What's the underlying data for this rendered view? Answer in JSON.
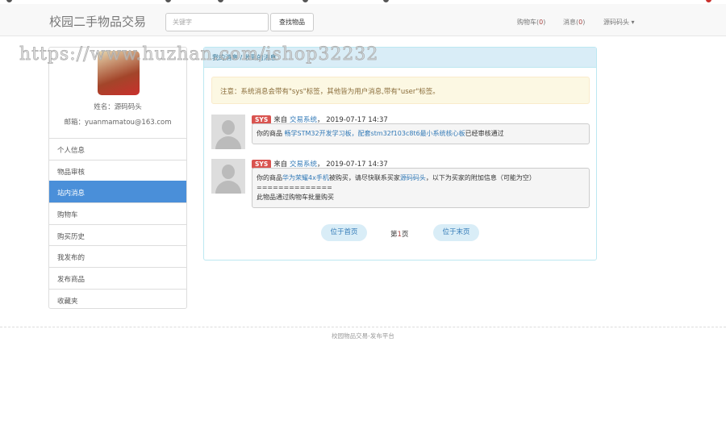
{
  "watermark": "https://www.huzhan.com/ishop32232",
  "navbar": {
    "brand": "校园二手物品交易",
    "search_placeholder": "关键字",
    "search_button": "查找物品",
    "cart_label": "购物车(",
    "cart_count": "0",
    "messages_label": "消息(",
    "messages_count": "0",
    "close_paren": ")",
    "user_menu": "源码码头 ▾"
  },
  "sidebar": {
    "name": "姓名：源码码头",
    "email": "邮箱：yuanmamatou@163.com",
    "items": [
      {
        "label": "个人信息"
      },
      {
        "label": "物品审核"
      },
      {
        "label": "站内消息"
      },
      {
        "label": "购物车"
      },
      {
        "label": "购买历史"
      },
      {
        "label": "我发布的"
      },
      {
        "label": "发布商品"
      },
      {
        "label": "收藏夹"
      }
    ]
  },
  "panel": {
    "title": "我的消息 / 收到的消息",
    "notice": "注意：系统消息会带有\"sys\"标签，其他皆为用户消息,带有\"user\"标签。",
    "messages": [
      {
        "tag": "SYS",
        "from_prefix": "来自",
        "from": "交易系统",
        "sep": "，",
        "time": "2019-07-17 14:37",
        "p1": "你的商品 ",
        "item": "畅学STM32开发学习板，配套stm32f103c8t6最小系统核心板",
        "p2": "已经审核通过"
      },
      {
        "tag": "SYS",
        "from_prefix": "来自",
        "from": "交易系统",
        "sep": "，",
        "time": "2019-07-17 14:37",
        "p1": "你的商品",
        "item": "华为荣耀4x手机",
        "p2": "被购买，请尽快联系买家",
        "buyer": "源码码头",
        "p3": "，以下为买家的附加信息（可能为空）",
        "divider": "==============",
        "extra": "此物品通过购物车批量购买"
      }
    ],
    "pagination": {
      "first": "位于首页",
      "current_prefix": "第",
      "current": "1",
      "current_suffix": "页",
      "last": "位于末页"
    }
  },
  "footer": "校园物品交易-发布平台",
  "colors": {
    "active": "#4a8fd9",
    "label": "#d9534f",
    "link": "#337ab7"
  }
}
